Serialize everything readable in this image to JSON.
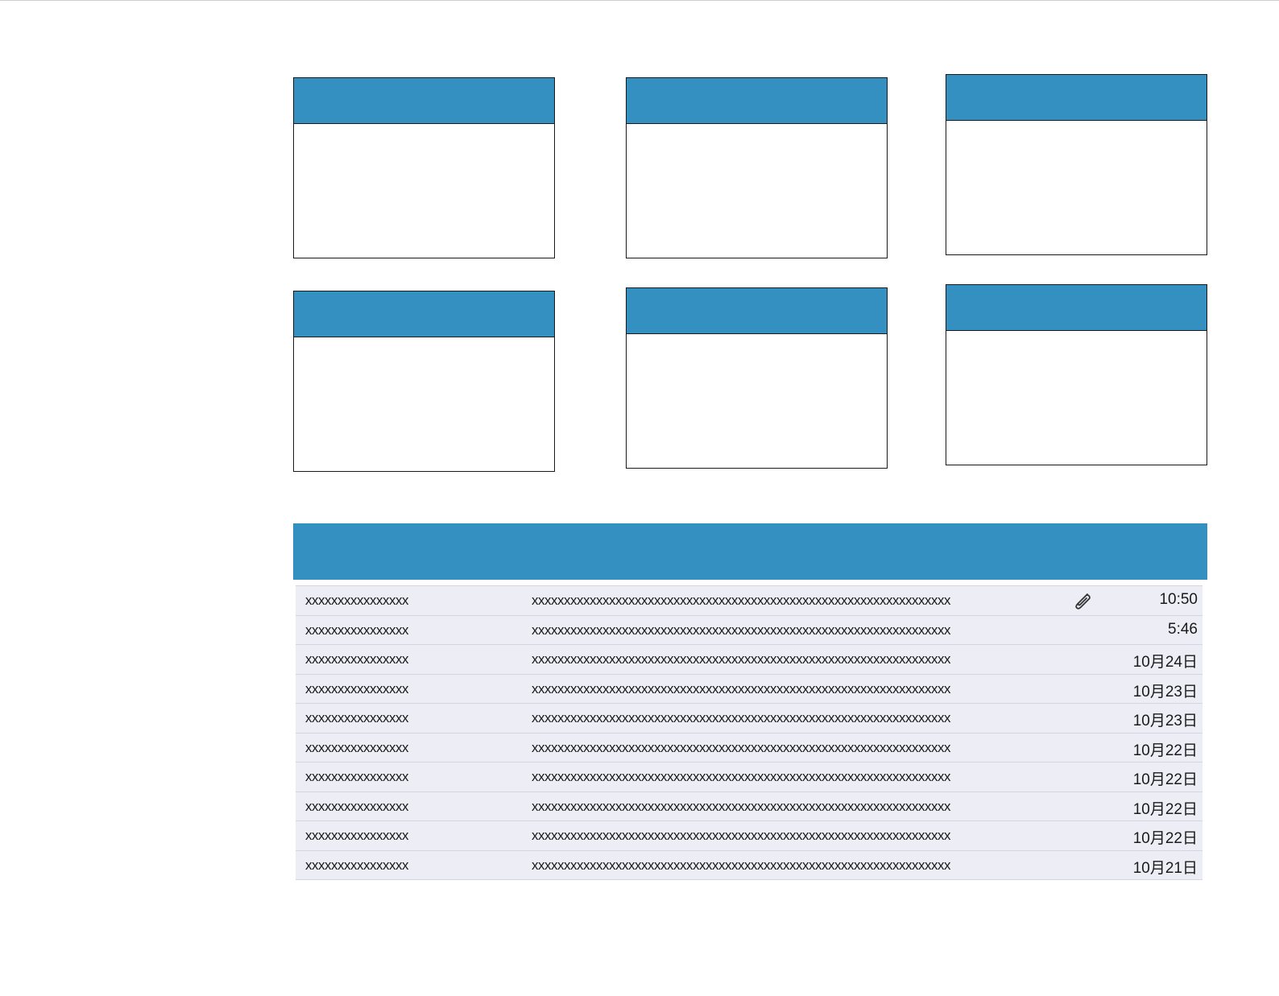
{
  "colors": {
    "accent": "#3390c0",
    "row_bg": "#ededf5",
    "border": "#1a1a1a"
  },
  "widgets": [
    {
      "id": "w1"
    },
    {
      "id": "w2"
    },
    {
      "id": "w3"
    },
    {
      "id": "w4"
    },
    {
      "id": "w5"
    },
    {
      "id": "w6"
    }
  ],
  "message_list": {
    "rows": [
      {
        "sender": "xxxxxxxxxxxxxxxx",
        "subject": "xxxxxxxxxxxxxxxxxxxxxxxxxxxxxxxxxxxxxxxxxxxxxxxxxxxxxxxxxxxxxxxxx",
        "attachment_icon": "paperclip-icon",
        "date": "10:50"
      },
      {
        "sender": "xxxxxxxxxxxxxxxx",
        "subject": "xxxxxxxxxxxxxxxxxxxxxxxxxxxxxxxxxxxxxxxxxxxxxxxxxxxxxxxxxxxxxxxxx",
        "attachment_icon": "",
        "date": "5:46"
      },
      {
        "sender": "xxxxxxxxxxxxxxxx",
        "subject": "xxxxxxxxxxxxxxxxxxxxxxxxxxxxxxxxxxxxxxxxxxxxxxxxxxxxxxxxxxxxxxxxx",
        "attachment_icon": "",
        "date": "10月24日"
      },
      {
        "sender": "xxxxxxxxxxxxxxxx",
        "subject": "xxxxxxxxxxxxxxxxxxxxxxxxxxxxxxxxxxxxxxxxxxxxxxxxxxxxxxxxxxxxxxxxx",
        "attachment_icon": "",
        "date": "10月23日"
      },
      {
        "sender": "xxxxxxxxxxxxxxxx",
        "subject": "xxxxxxxxxxxxxxxxxxxxxxxxxxxxxxxxxxxxxxxxxxxxxxxxxxxxxxxxxxxxxxxxx",
        "attachment_icon": "",
        "date": "10月23日"
      },
      {
        "sender": "xxxxxxxxxxxxxxxx",
        "subject": "xxxxxxxxxxxxxxxxxxxxxxxxxxxxxxxxxxxxxxxxxxxxxxxxxxxxxxxxxxxxxxxxx",
        "attachment_icon": "",
        "date": "10月22日"
      },
      {
        "sender": "xxxxxxxxxxxxxxxx",
        "subject": "xxxxxxxxxxxxxxxxxxxxxxxxxxxxxxxxxxxxxxxxxxxxxxxxxxxxxxxxxxxxxxxxx",
        "attachment_icon": "",
        "date": "10月22日"
      },
      {
        "sender": "xxxxxxxxxxxxxxxx",
        "subject": "xxxxxxxxxxxxxxxxxxxxxxxxxxxxxxxxxxxxxxxxxxxxxxxxxxxxxxxxxxxxxxxxx",
        "attachment_icon": "",
        "date": "10月22日"
      },
      {
        "sender": "xxxxxxxxxxxxxxxx",
        "subject": "xxxxxxxxxxxxxxxxxxxxxxxxxxxxxxxxxxxxxxxxxxxxxxxxxxxxxxxxxxxxxxxxx",
        "attachment_icon": "",
        "date": "10月22日"
      },
      {
        "sender": "xxxxxxxxxxxxxxxx",
        "subject": "xxxxxxxxxxxxxxxxxxxxxxxxxxxxxxxxxxxxxxxxxxxxxxxxxxxxxxxxxxxxxxxxx",
        "attachment_icon": "",
        "date": "10月21日"
      }
    ]
  }
}
